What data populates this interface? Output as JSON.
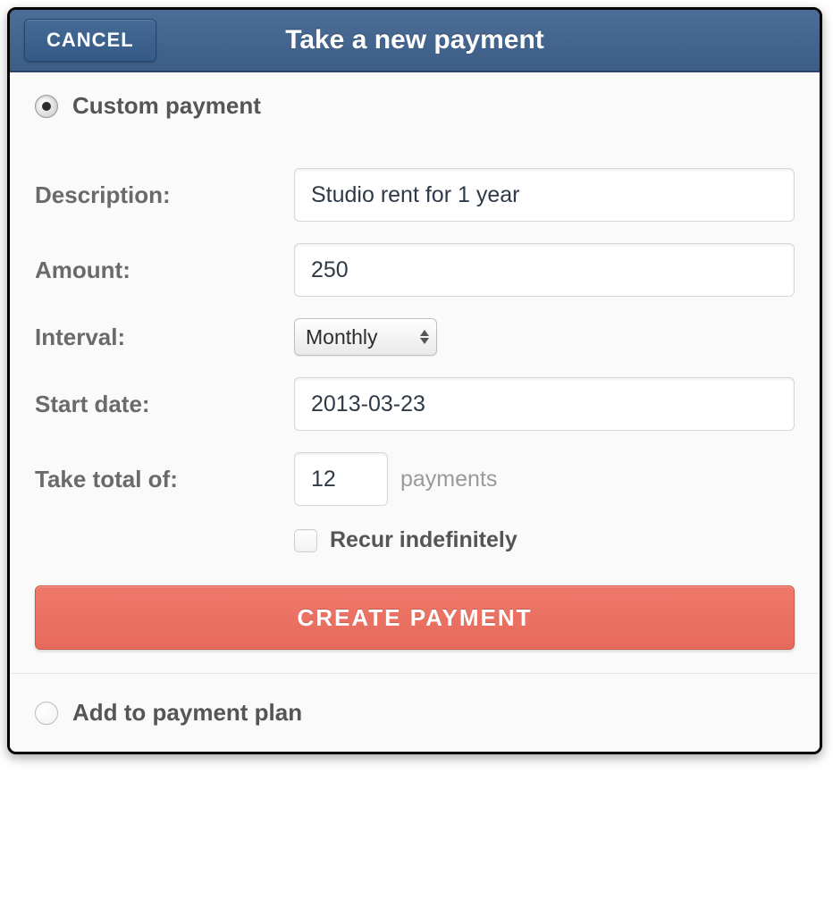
{
  "titlebar": {
    "cancel_label": "CANCEL",
    "title": "Take a new payment"
  },
  "sections": {
    "custom_label": "Custom payment",
    "plan_label": "Add to payment plan"
  },
  "form": {
    "description_label": "Description:",
    "description_value": "Studio rent for 1 year",
    "amount_label": "Amount:",
    "amount_value": "250",
    "interval_label": "Interval:",
    "interval_value": "Monthly",
    "start_label": "Start date:",
    "start_value": "2013-03-23",
    "total_label": "Take total of:",
    "total_value": "12",
    "total_suffix": "payments",
    "recur_label": "Recur indefinitely",
    "create_label": "CREATE PAYMENT"
  }
}
